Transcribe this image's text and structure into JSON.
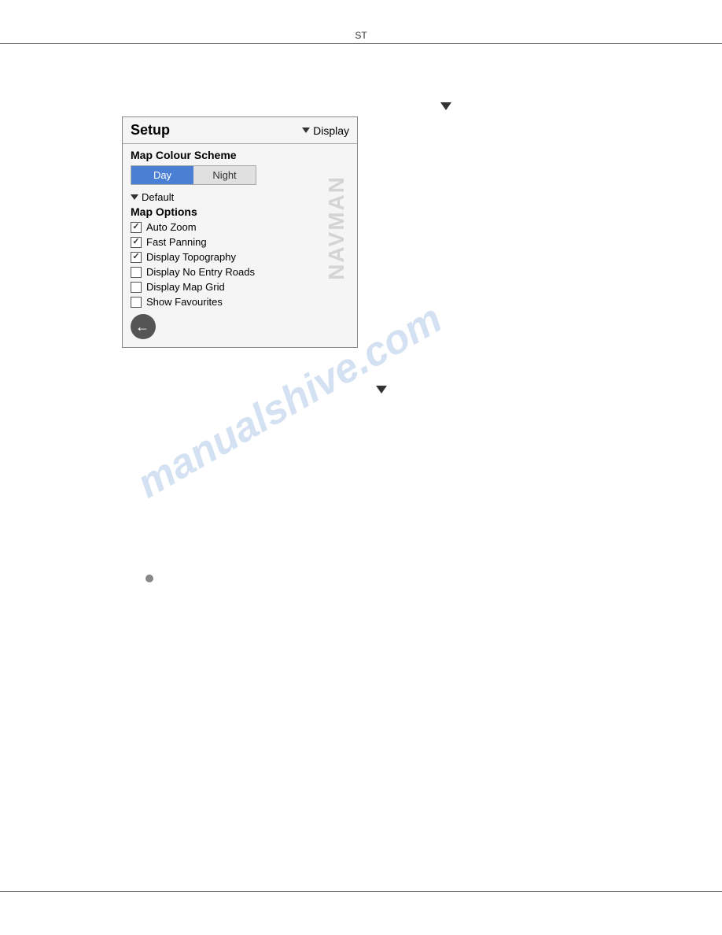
{
  "page": {
    "st_label": "ST",
    "website_watermark": "manualshive.com",
    "navman_watermark": "NAVMAN"
  },
  "dialog": {
    "title": "Setup",
    "display_label": "Display",
    "map_colour_scheme_label": "Map Colour Scheme",
    "day_button": "Day",
    "night_button": "Night",
    "default_label": "Default",
    "map_options_label": "Map Options",
    "checkboxes": [
      {
        "label": "Auto Zoom",
        "checked": true
      },
      {
        "label": "Fast Panning",
        "checked": true
      },
      {
        "label": "Display Topography",
        "checked": true
      },
      {
        "label": "Display No Entry Roads",
        "checked": false
      },
      {
        "label": "Display Map Grid",
        "checked": false
      },
      {
        "label": "Show Favourites",
        "checked": false
      }
    ],
    "back_button_label": "←"
  }
}
